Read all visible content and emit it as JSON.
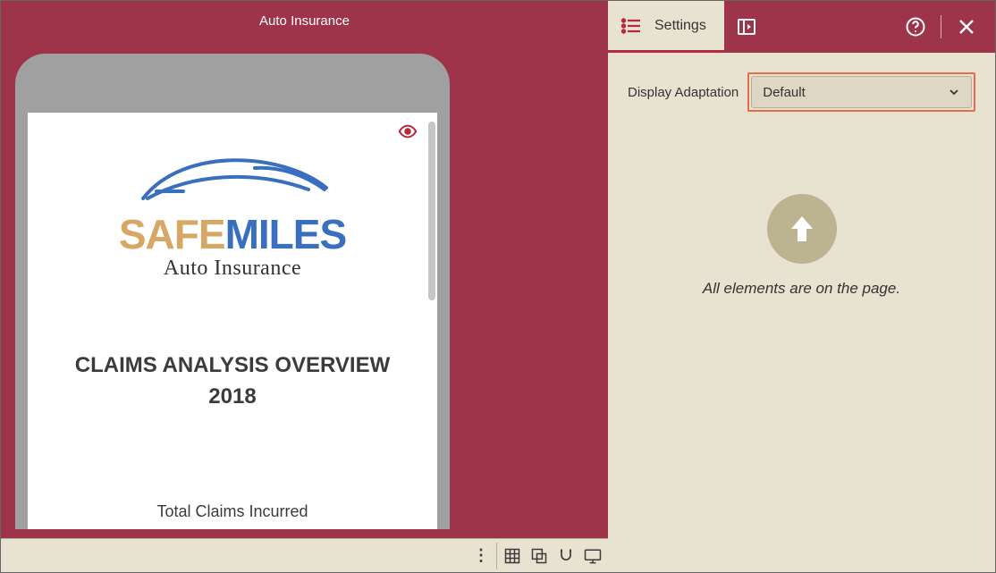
{
  "left": {
    "title": "Auto Insurance",
    "logo": {
      "word1": "SAFE",
      "word2": "MILES",
      "subtitle": "Auto Insurance"
    },
    "overview": {
      "line1": "CLAIMS ANALYSIS OVERVIEW",
      "line2": "2018"
    },
    "total_claims_label": "Total Claims Incurred"
  },
  "right": {
    "tab_label": "Settings",
    "display_adaptation": {
      "label": "Display Adaptation",
      "value": "Default"
    },
    "empty_message": "All elements are on the page."
  }
}
